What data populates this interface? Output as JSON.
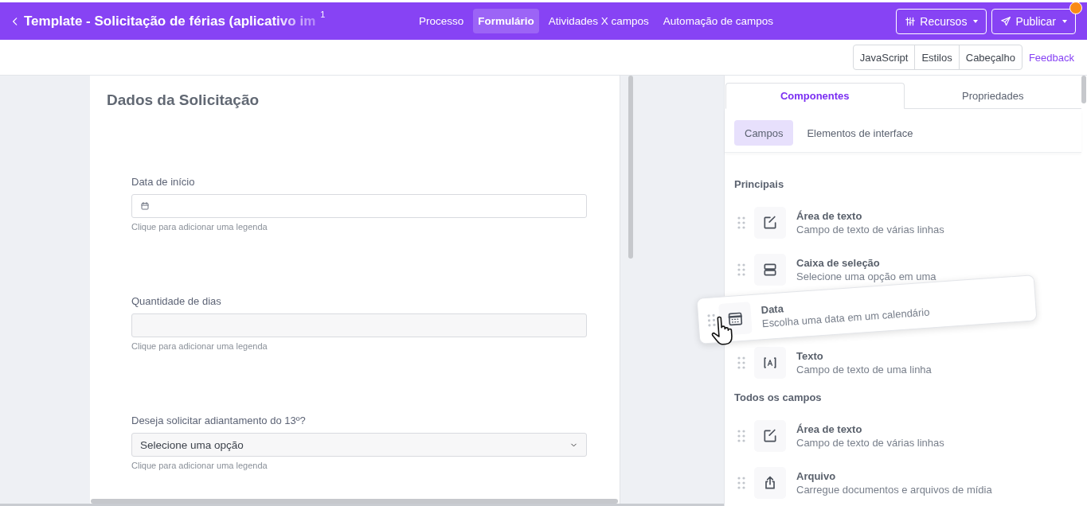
{
  "header": {
    "title": "Template - Solicitação de férias (aplicativo im",
    "badge": "1",
    "nav": [
      {
        "label": "Processo",
        "selected": false
      },
      {
        "label": "Formulário",
        "selected": true
      },
      {
        "label": "Atividades X campos",
        "selected": false
      },
      {
        "label": "Automação de campos",
        "selected": false
      }
    ],
    "buttons": [
      {
        "label": "Recursos",
        "kind": "resources",
        "notification": false
      },
      {
        "label": "Publicar",
        "kind": "publish",
        "notification": true
      }
    ]
  },
  "toolbar": {
    "buttons": [
      "JavaScript",
      "Estilos",
      "Cabeçalho"
    ],
    "link": "Feedback"
  },
  "form": {
    "title": "Dados da Solicitação",
    "fields": [
      {
        "kind": "date",
        "label": "Data de início",
        "caption": "Clique para adicionar uma legenda"
      },
      {
        "kind": "number",
        "label": "Quantidade de dias",
        "caption": "Clique para adicionar uma legenda"
      },
      {
        "kind": "select",
        "label": "Deseja solicitar adiantamento do 13º?",
        "value": "Selecione uma opção",
        "caption": "Clique para adicionar uma legenda"
      }
    ]
  },
  "panel": {
    "tabs": [
      {
        "label": "Componentes",
        "selected": true
      },
      {
        "label": "Propriedades",
        "selected": false
      }
    ],
    "subtabs": [
      {
        "label": "Campos",
        "selected": true
      },
      {
        "label": "Elementos de interface",
        "selected": false
      }
    ],
    "sections": [
      {
        "title": "Principais",
        "items": [
          {
            "kind": "textarea",
            "dragging": false,
            "title": "Área de texto",
            "description": "Campo de texto de várias linhas"
          },
          {
            "kind": "select",
            "dragging": false,
            "title": "Caixa de seleção",
            "description": "Selecione uma opção em uma"
          },
          {
            "kind": "date",
            "dragging": true,
            "title": "Data",
            "description": "Escolha uma data em um calendário"
          },
          {
            "kind": "text",
            "dragging": false,
            "title": "Texto",
            "description": "Campo de texto de uma linha"
          }
        ]
      },
      {
        "title": "Todos os campos",
        "items": [
          {
            "kind": "textarea",
            "dragging": false,
            "title": "Área de texto",
            "description": "Campo de texto de várias linhas"
          },
          {
            "kind": "file",
            "dragging": false,
            "title": "Arquivo",
            "description": "Carregue documentos e arquivos de mídia"
          }
        ]
      }
    ]
  }
}
